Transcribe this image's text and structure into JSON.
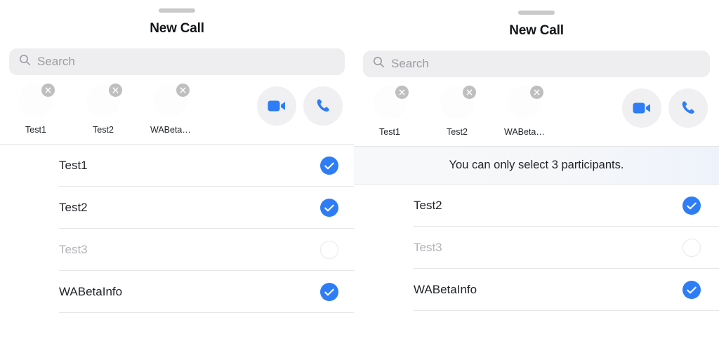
{
  "panels": [
    {
      "id": "panel-a",
      "title": "New Call",
      "search": {
        "placeholder": "Search",
        "value": ""
      },
      "chips": [
        {
          "label": "Test1",
          "remove_icon": "close-icon"
        },
        {
          "label": "Test2",
          "remove_icon": "close-icon"
        },
        {
          "label": "WABetaI...",
          "remove_icon": "close-icon"
        }
      ],
      "actions": [
        {
          "name": "video-call-button",
          "icon": "video-camera-icon",
          "color": "#2e7df6"
        },
        {
          "name": "voice-call-button",
          "icon": "phone-icon",
          "color": "#2e7df6"
        }
      ],
      "toast": null,
      "rows": [
        {
          "name": "Test1",
          "selected": true,
          "disabled": false
        },
        {
          "name": "Test2",
          "selected": true,
          "disabled": false
        },
        {
          "name": "Test3",
          "selected": false,
          "disabled": true
        },
        {
          "name": "WABetaInfo",
          "selected": true,
          "disabled": false
        }
      ]
    },
    {
      "id": "panel-b",
      "title": "New Call",
      "search": {
        "placeholder": "Search",
        "value": ""
      },
      "chips": [
        {
          "label": "Test1",
          "remove_icon": "close-icon"
        },
        {
          "label": "Test2",
          "remove_icon": "close-icon"
        },
        {
          "label": "WABetaI...",
          "remove_icon": "close-icon"
        }
      ],
      "actions": [
        {
          "name": "video-call-button",
          "icon": "video-camera-icon",
          "color": "#2e7df6"
        },
        {
          "name": "voice-call-button",
          "icon": "phone-icon",
          "color": "#2e7df6"
        }
      ],
      "toast": {
        "message": "You can only select 3 participants."
      },
      "rows": [
        {
          "name": "Test2",
          "selected": true,
          "disabled": false
        },
        {
          "name": "Test3",
          "selected": false,
          "disabled": true
        },
        {
          "name": "WABetaInfo",
          "selected": true,
          "disabled": false
        }
      ]
    }
  ],
  "colors": {
    "accent_blue": "#2e7df6",
    "search_background": "#eeeef0",
    "action_background": "#f0f0f2",
    "chip_remove": "#bfbfbf",
    "divider": "#e6e6e8",
    "text_primary": "#1f2328",
    "text_disabled": "#b3b3b8",
    "placeholder": "#9c9ca1"
  },
  "icons": {
    "search": "search-icon",
    "grabber": "sheet-grabber"
  }
}
